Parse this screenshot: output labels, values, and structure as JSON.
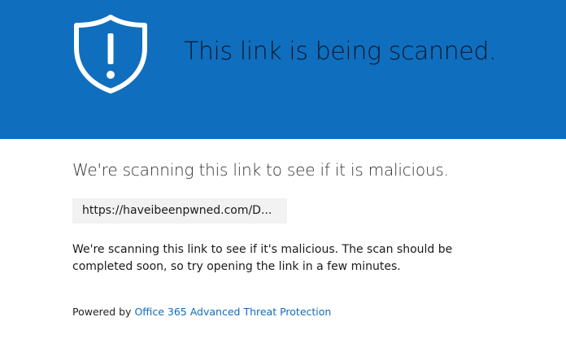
{
  "banner": {
    "title": "This link is being scanned.",
    "icon": "shield-exclamation-icon",
    "color": "#106ebe"
  },
  "main": {
    "heading": "We're scanning this link to see if it is malicious.",
    "url": "https://haveibeenpwned.com/D...",
    "description": "We're scanning this link to see if it's malicious. The scan should be completed soon, so try opening the link in a few minutes."
  },
  "footer": {
    "powered_prefix": "Powered by",
    "link_text": "Office 365 Advanced Threat Protection",
    "link_color": "#0f6cbd"
  }
}
